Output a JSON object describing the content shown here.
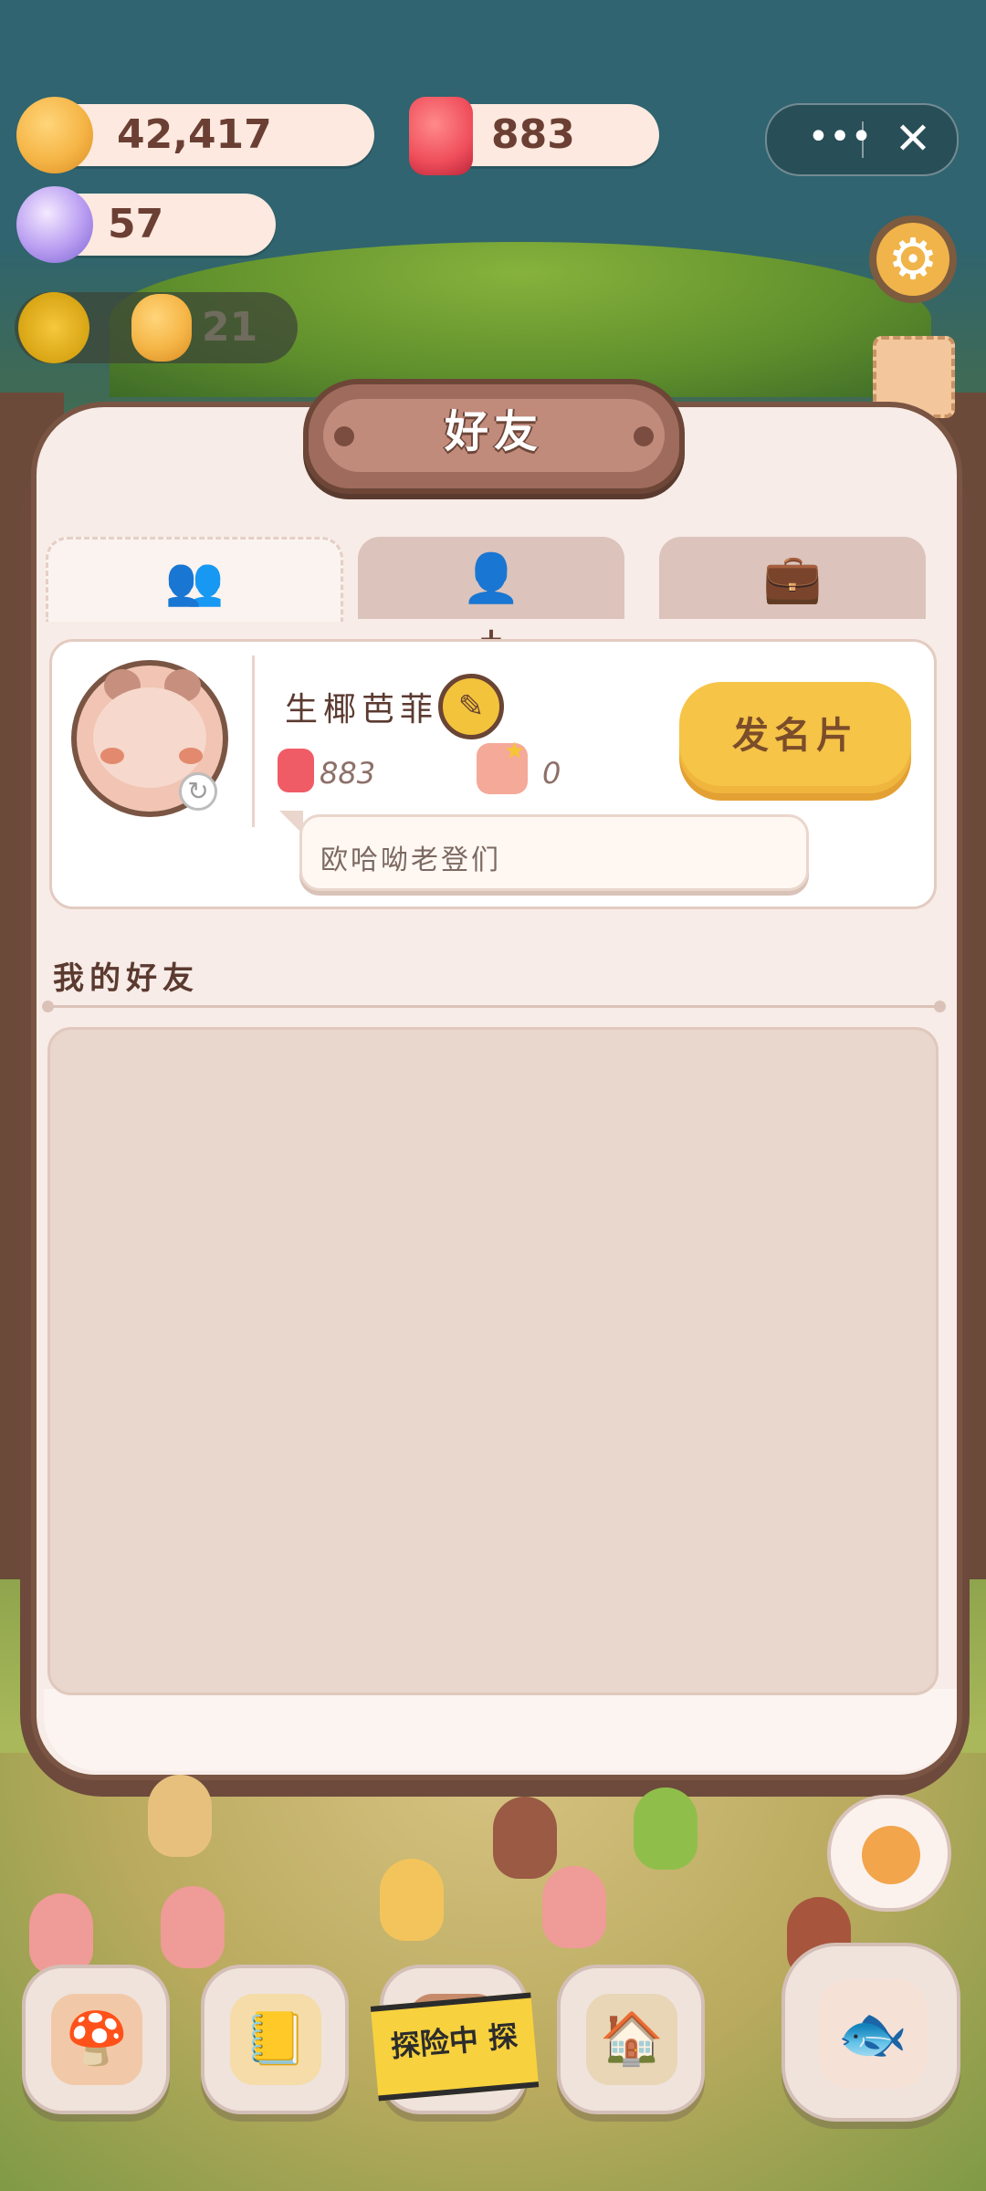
{
  "hud": {
    "cookies": "42,417",
    "candy": "883",
    "gems": "57",
    "level_count": "21",
    "more_label": "•••",
    "close_label": "✕"
  },
  "modal": {
    "title": "好友",
    "tabs": [
      {
        "icon": "friends-icon",
        "glyph": "👥"
      },
      {
        "icon": "add-friend-icon",
        "glyph": "👤"
      },
      {
        "icon": "briefcase-icon",
        "glyph": "💼"
      }
    ],
    "profile": {
      "name": "生椰芭菲",
      "candy_count": "883",
      "like_count": "0",
      "send_card_label": "发名片",
      "motto": "欧哈呦老登们"
    },
    "friends_section_title": "我的好友",
    "friends": []
  },
  "bottom_nav": {
    "expedition_label": "探险中 探",
    "items": [
      "house-icon",
      "notebook-icon",
      "expedition-icon",
      "shop-icon",
      "fishing-icon"
    ]
  },
  "colors": {
    "accent_yellow": "#f6c446",
    "panel_brown": "#7a5544",
    "panel_bg": "#f7ece7"
  }
}
